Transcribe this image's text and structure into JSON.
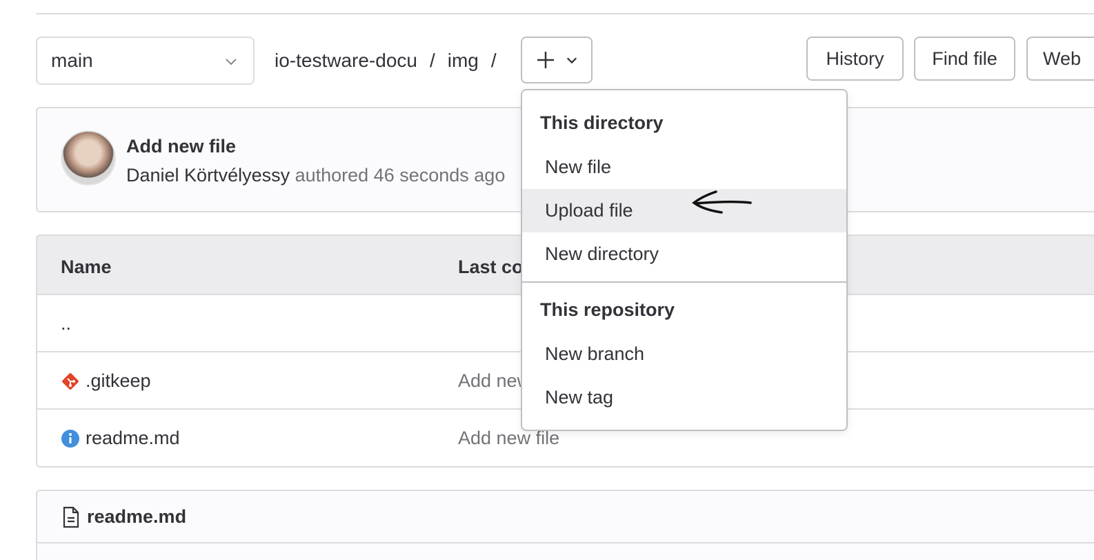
{
  "toolbar": {
    "branch": "main",
    "breadcrumb": [
      "io-testware-docu",
      "img"
    ],
    "breadcrumb_separator": "/",
    "history_label": "History",
    "find_file_label": "Find file",
    "web_ide_label": "Web"
  },
  "commit": {
    "title": "Add new file",
    "author": "Daniel Körtvélyessy",
    "meta": " authored 46 seconds ago"
  },
  "table": {
    "columns": [
      "Name",
      "Last co"
    ],
    "rows": [
      {
        "name": "..",
        "message": ""
      },
      {
        "name": ".gitkeep",
        "message": "Add new",
        "icon": "git-icon"
      },
      {
        "name": "readme.md",
        "message": "Add new file",
        "icon": "info-icon"
      }
    ]
  },
  "readme": {
    "title": "readme.md"
  },
  "dropdown": {
    "section1_header": "This directory",
    "new_file": "New file",
    "upload_file": "Upload file",
    "new_directory": "New directory",
    "section2_header": "This repository",
    "new_branch": "New branch",
    "new_tag": "New tag"
  },
  "colors": {
    "accent_git": "#e24329",
    "accent_info": "#428fdc",
    "hover_bg": "#ececef"
  }
}
